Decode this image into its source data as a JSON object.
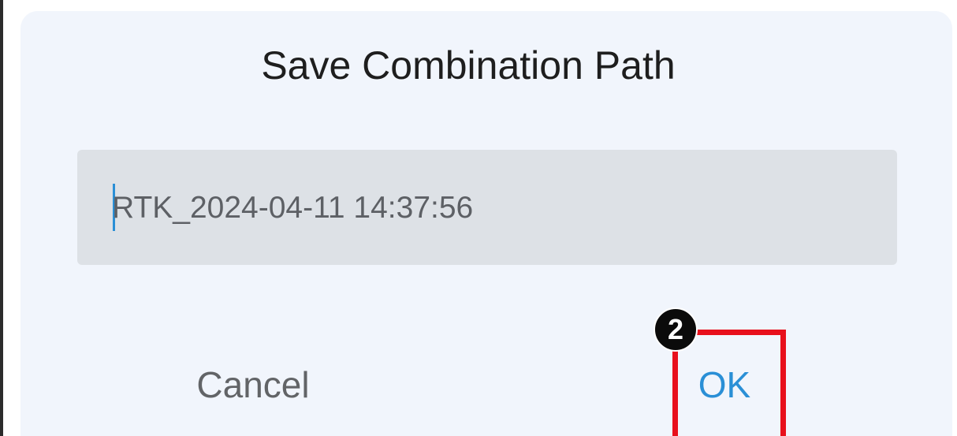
{
  "dialog": {
    "title": "Save Combination Path",
    "path_input": {
      "value": "RTK_2024-04-11 14:37:56"
    },
    "cancel_label": "Cancel",
    "ok_label": "OK"
  },
  "annotation": {
    "step_number": "2",
    "highlight_color": "#e8101c"
  },
  "colors": {
    "accent": "#2a8fd6",
    "dialog_background": "#f1f5fc",
    "input_background": "#dde1e6"
  }
}
